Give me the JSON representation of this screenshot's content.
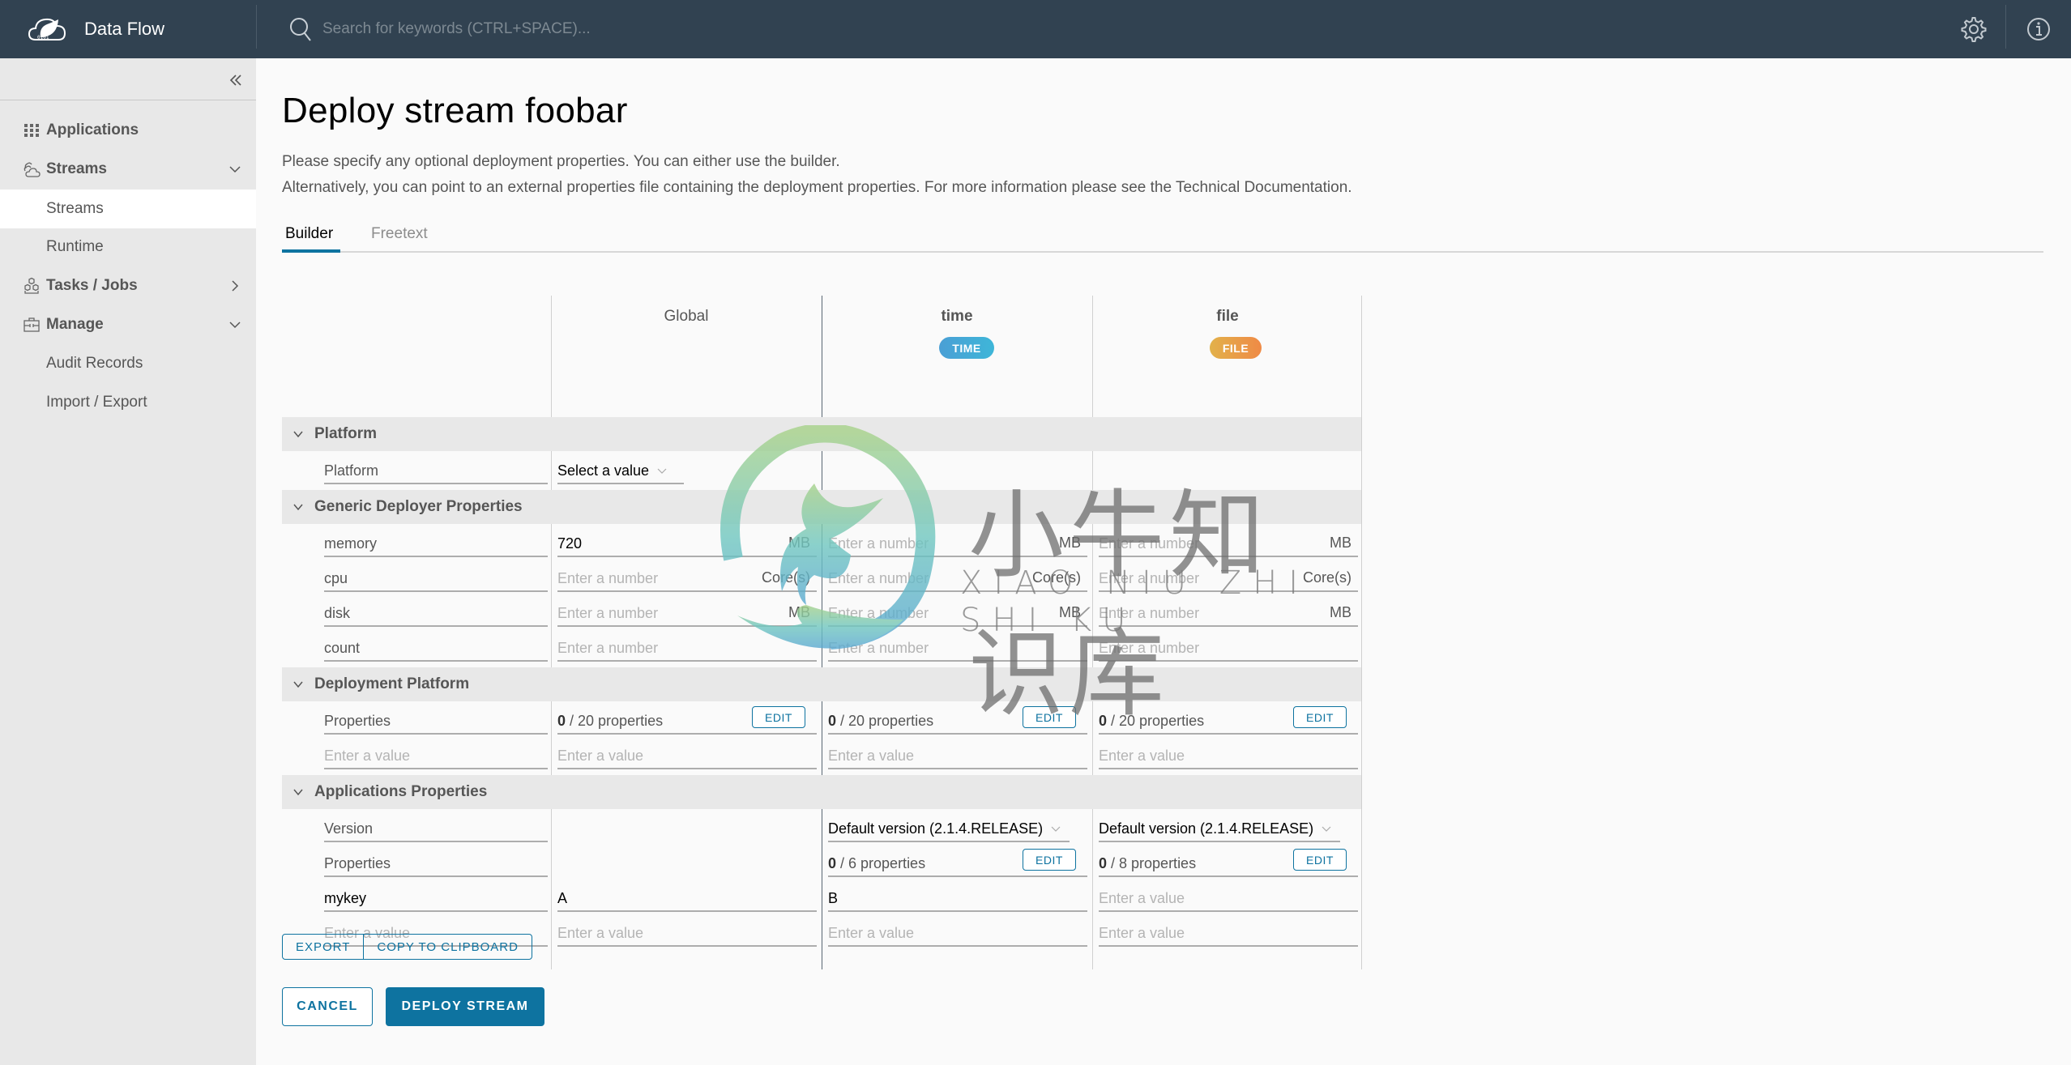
{
  "app": {
    "name": "Data Flow"
  },
  "header": {
    "search_placeholder": "Search for keywords (CTRL+SPACE)...",
    "icons": [
      "settings-icon",
      "info-icon"
    ]
  },
  "sidebar": {
    "items": [
      {
        "label": "Applications",
        "icon": "grid-icon",
        "type": "group"
      },
      {
        "label": "Streams",
        "icon": "streams-icon",
        "type": "group",
        "expanded": true
      },
      {
        "label": "Streams",
        "type": "sub",
        "active": true
      },
      {
        "label": "Runtime",
        "type": "sub"
      },
      {
        "label": "Tasks / Jobs",
        "icon": "tasks-icon",
        "type": "group",
        "expanded": false
      },
      {
        "label": "Manage",
        "icon": "manage-icon",
        "type": "group",
        "expanded": true
      },
      {
        "label": "Audit Records",
        "type": "sub"
      },
      {
        "label": "Import / Export",
        "type": "sub"
      }
    ]
  },
  "page": {
    "title": "Deploy stream foobar",
    "description_1": "Please specify any optional deployment properties. You can either use the builder.",
    "description_2": "Alternatively, you can point to an external properties file containing the deployment properties. For more information please see the Technical Documentation.",
    "tabs": [
      {
        "label": "Builder",
        "active": true
      },
      {
        "label": "Freetext",
        "active": false
      }
    ]
  },
  "builder": {
    "columns": [
      {
        "name": "Global"
      },
      {
        "name": "time",
        "badge": "TIME",
        "badge_colors": [
          "#4a9fd5",
          "#3eb6d8"
        ]
      },
      {
        "name": "file",
        "badge": "FILE",
        "badge_colors": [
          "#e2b14a",
          "#ef8a46"
        ]
      }
    ],
    "sections": {
      "platform": {
        "label": "Platform",
        "rows": {
          "platform": {
            "label": "Platform",
            "global_select": "Select a value"
          }
        }
      },
      "generic": {
        "label": "Generic Deployer Properties",
        "rows": {
          "memory": {
            "label": "memory",
            "unit": "MB",
            "global": "720",
            "time": "",
            "file": ""
          },
          "cpu": {
            "label": "cpu",
            "unit": "Core(s)",
            "global": "",
            "time": "",
            "file": ""
          },
          "disk": {
            "label": "disk",
            "unit": "MB",
            "global": "",
            "time": "",
            "file": ""
          },
          "count": {
            "label": "count",
            "unit": "",
            "global": "",
            "time": "",
            "file": ""
          }
        },
        "number_placeholder": "Enter a number"
      },
      "deployment": {
        "label": "Deployment Platform",
        "properties_label": "Properties",
        "global_count": "0",
        "global_total": " / 20 properties",
        "time_count": "0",
        "time_total": " / 20 properties",
        "file_count": "0",
        "file_total": " / 20 properties",
        "edit_label": "EDIT",
        "value_placeholder": "Enter a value"
      },
      "applications": {
        "label": "Applications Properties",
        "version_label": "Version",
        "time_version": "Default version (2.1.4.RELEASE)",
        "file_version": "Default version (2.1.4.RELEASE)",
        "properties_label": "Properties",
        "time_count": "0",
        "time_total": " / 6 properties",
        "file_count": "0",
        "file_total": " / 8 properties",
        "edit_label": "EDIT",
        "custom_key": "mykey",
        "custom_global": "A",
        "custom_time": "B",
        "custom_file": "",
        "value_placeholder": "Enter a value"
      }
    }
  },
  "actions": {
    "export": "EXPORT",
    "copy": "COPY TO CLIPBOARD",
    "cancel": "CANCEL",
    "deploy": "DEPLOY STREAM"
  },
  "watermark": {
    "cn": "小牛知识库",
    "en": "XIAO NIU ZHI SHI KU"
  },
  "colors": {
    "header_bg": "#314251",
    "primary": "#0e73a0",
    "sidebar_bg": "#e8e8e8",
    "section_bg": "#e8e8e8"
  }
}
